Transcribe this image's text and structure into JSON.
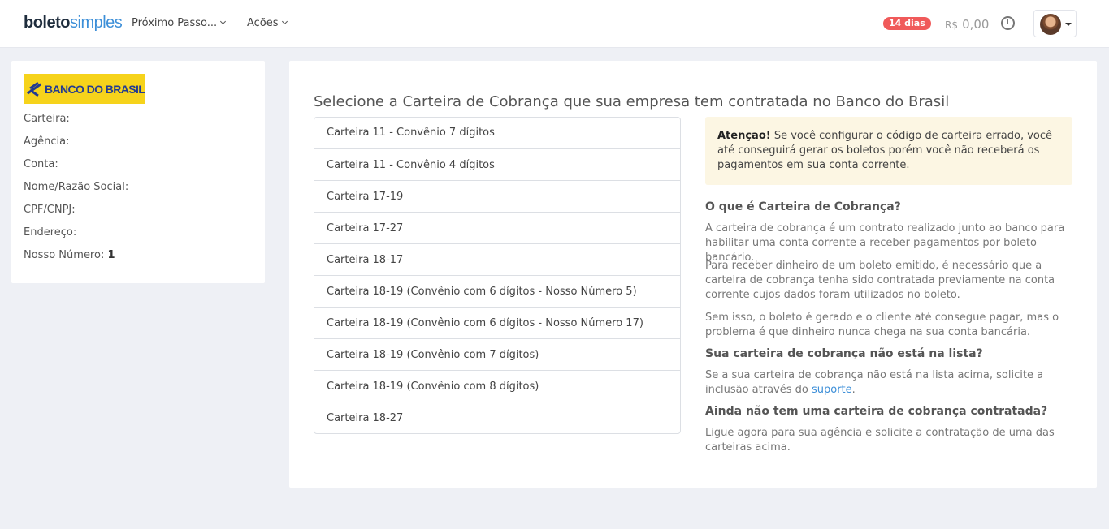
{
  "navbar": {
    "logo_part1": "boleto",
    "logo_part2": "simples",
    "menu_next_steps": "Próximo Passo...",
    "menu_actions": "Ações",
    "trial_badge": "14 dias",
    "balance_currency": "R$",
    "balance_amount": "0,00",
    "icons": [
      "chevron-down-icon",
      "clock-icon",
      "avatar",
      "caret-down-icon"
    ]
  },
  "bank_card": {
    "bank_logo_text": "BANCO DO BRASIL",
    "fields": [
      {
        "label": "Carteira:",
        "value": ""
      },
      {
        "label": "Agência:",
        "value": ""
      },
      {
        "label": "Conta:",
        "value": ""
      },
      {
        "label": "Nome/Razão Social:",
        "value": ""
      },
      {
        "label": "CPF/CNPJ:",
        "value": ""
      },
      {
        "label": "Endereço:",
        "value": ""
      },
      {
        "label": "Nosso Número:",
        "value": "1"
      }
    ]
  },
  "main": {
    "title": "Selecione a Carteira de Cobrança que sua empresa tem contratada no Banco do Brasil",
    "wallets": [
      "Carteira 11 - Convênio 7 dígitos",
      "Carteira 11 - Convênio 4 dígitos",
      "Carteira 17-19",
      "Carteira 17-27",
      "Carteira 18-17",
      "Carteira 18-19 (Convênio com 6 dígitos - Nosso Número 5)",
      "Carteira 18-19 (Convênio com 6 dígitos - Nosso Número 17)",
      "Carteira 18-19 (Convênio com 7 dígitos)",
      "Carteira 18-19 (Convênio com 8 dígitos)",
      "Carteira 18-27"
    ],
    "alert_strong": "Atenção!",
    "alert_text": " Se você configurar o código de carteira errado, você até conseguirá gerar os boletos porém você não receberá os pagamentos em sua conta corrente.",
    "what_is_heading": "O que é Carteira de Cobrança?",
    "what_is_p1": "A carteira de cobrança é um contrato realizado junto ao banco para habilitar uma conta corrente a receber pagamentos por boleto bancário.",
    "what_is_p2": "Para receber dinheiro de um boleto emitido, é necessário que a carteira de cobrança tenha sido contratada previamente na conta corrente cujos dados foram utilizados no boleto.",
    "what_is_p3": "Sem isso, o boleto é gerado e o cliente até consegue pagar, mas o problema é que dinheiro nunca chega na sua conta bancária.",
    "not_listed_heading": "Sua carteira de cobrança não está na lista?",
    "not_listed_text": "Se a sua carteira de cobrança não está na lista acima, solicite a inclusão através do ",
    "support_link": "suporte",
    "not_listed_end": ".",
    "no_wallet_heading": "Ainda não tem uma carteira de cobrança contratada?",
    "no_wallet_text": "Ligue agora para sua agência e solicite a contratação de uma das carteiras acima."
  }
}
